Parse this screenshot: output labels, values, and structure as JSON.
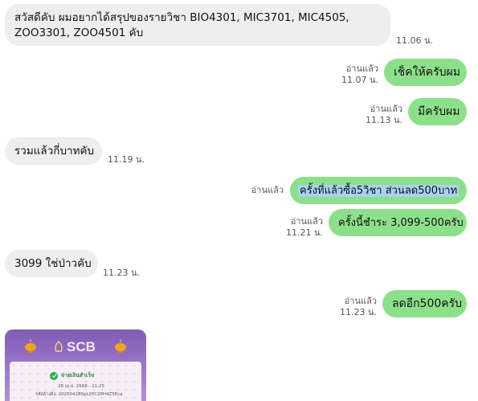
{
  "messages": [
    {
      "side": "in",
      "lines": [
        "สวัสดีคับ ผมอยากได้สรุปของรายวิชา BIO4301, MIC3701, MIC4505,",
        "ZOO3301, ZOO4501 คับ"
      ],
      "time": "11.06 น."
    },
    {
      "side": "out",
      "text": "เช็คให้ครับผม",
      "read": "อ่านแล้ว",
      "time": "11.07 น."
    },
    {
      "side": "out",
      "text": "มีครับผม",
      "read": "อ่านแล้ว",
      "time": "11.13 น."
    },
    {
      "side": "in",
      "text": "รวมแล้วกี่บาทคับ",
      "time": "11.19 น."
    },
    {
      "side": "out",
      "text": "ครั้งที่แล้วซื้อ5วิชา ส่วนลด500บาท",
      "read": "อ่านแล้ว",
      "time": ""
    },
    {
      "side": "out",
      "text": "ครั้งนี้ชำระ 3,099-500ครับ",
      "read": "อ่านแล้ว",
      "time": "11.21 น."
    },
    {
      "side": "in",
      "text": "3099 ใช่ป่าวคับ",
      "time": "11.23 น."
    },
    {
      "side": "out",
      "text": "ลดอีก500ครับ",
      "read": "อ่านแล้ว",
      "time": "11.23 น."
    }
  ],
  "slip": {
    "bank": "SCB",
    "status": "จ่ายเงินสำเร็จ",
    "date": "28 เม.ย. 2568 - 11:25",
    "ref": "รหัสอ้างอิง: 202504280pL0YC2PH4Z5Eca"
  }
}
